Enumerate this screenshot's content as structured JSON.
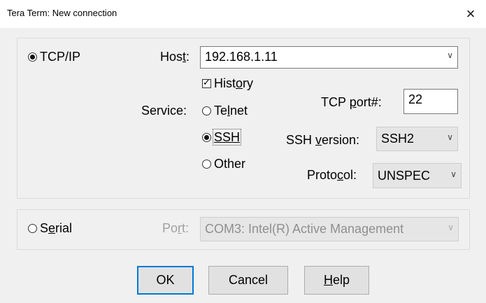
{
  "window": {
    "title": "Tera Term: New connection",
    "close_glyph": "×"
  },
  "tcpip": {
    "radio_label": "TCP/IP",
    "selected": true,
    "host_label": {
      "pre": "Hos",
      "ul": "t",
      "post": ":"
    },
    "host_value": "192.168.1.11",
    "history": {
      "pre": "Hist",
      "ul": "o",
      "post": "ry",
      "checked": true
    },
    "service_label": "Service:",
    "services": [
      {
        "pre": "Te",
        "ul": "l",
        "post": "net",
        "selected": false
      },
      {
        "pre": "",
        "ul": "SSH",
        "post": "",
        "selected": true
      },
      {
        "pre": "Other",
        "ul": "",
        "post": "",
        "selected": false
      }
    ],
    "tcp_port_label": {
      "pre": "TCP ",
      "ul": "p",
      "post": "ort#:"
    },
    "tcp_port_value": "22",
    "ssh_version_label": {
      "pre": "SSH ",
      "ul": "v",
      "post": "ersion:"
    },
    "ssh_version_value": "SSH2",
    "protocol_label": {
      "pre": "Proto",
      "ul": "c",
      "post": "ol:"
    },
    "protocol_value": "UNSPEC"
  },
  "serial": {
    "radio_label": {
      "pre": "S",
      "ul": "e",
      "post": "rial"
    },
    "selected": false,
    "port_label": {
      "pre": "Po",
      "ul": "r",
      "post": "t:"
    },
    "port_value": "COM3: Intel(R) Active Management"
  },
  "buttons": {
    "ok": "OK",
    "cancel": "Cancel",
    "help": {
      "pre": "",
      "ul": "H",
      "post": "elp"
    }
  },
  "icons": {
    "dropdown": "chevron-down-icon",
    "close": "close-icon"
  },
  "colors": {
    "accent_default_button": "#0078d7",
    "dialog_bg": "#f0f0f0"
  }
}
